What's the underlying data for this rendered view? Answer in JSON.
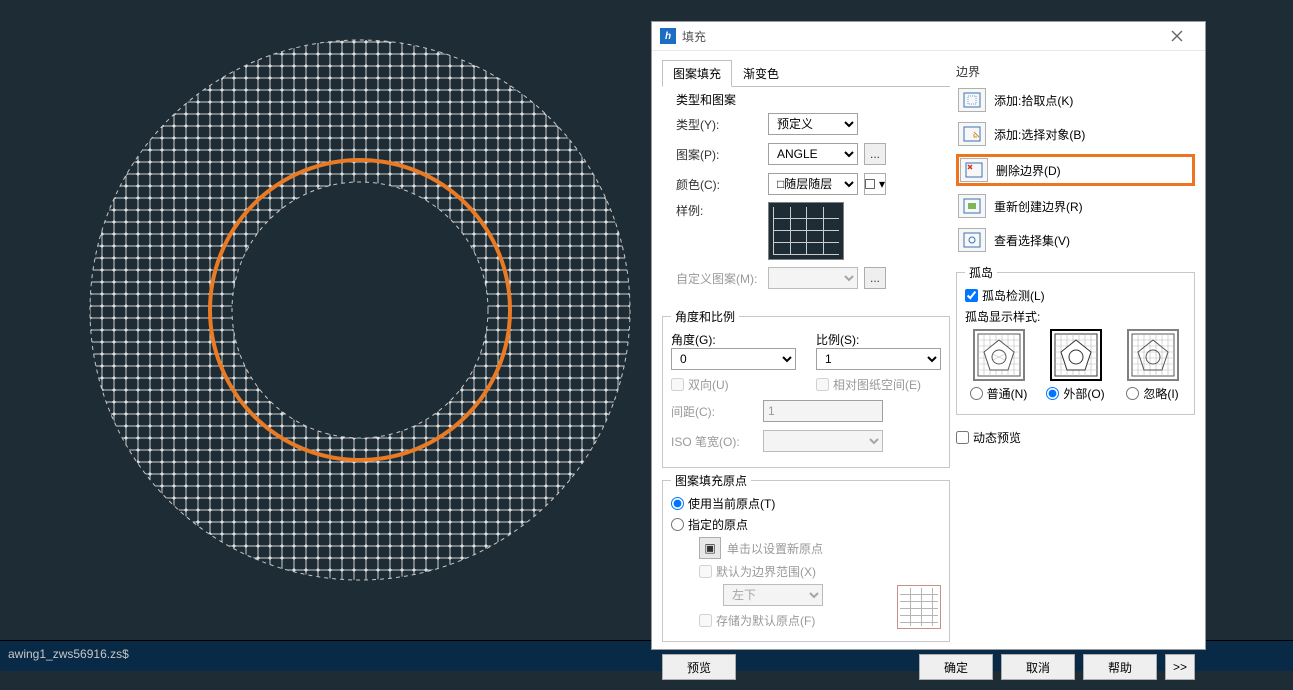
{
  "status_line": "awing1_zws56916.zs$",
  "dialog": {
    "title": "填充",
    "tabs": {
      "pattern": "图案填充",
      "gradient": "渐变色"
    },
    "type_group_title": "类型和图案",
    "type_label": "类型(Y):",
    "type_value": "预定义",
    "pattern_label": "图案(P):",
    "pattern_value": "ANGLE",
    "color_label": "颜色(C):",
    "color_value": "随层",
    "sample_label": "样例:",
    "custom_label": "自定义图案(M):",
    "ellipsis": "...",
    "angle_scale_title": "角度和比例",
    "angle_label": "角度(G):",
    "angle_value": "0",
    "scale_label": "比例(S):",
    "scale_value": "1",
    "double_dir": "双向(U)",
    "rel_paper": "相对图纸空间(E)",
    "spacing_label": "间距(C):",
    "spacing_value": "1",
    "iso_pen_label": "ISO 笔宽(O):",
    "origin_title": "图案填充原点",
    "use_current": "使用当前原点(T)",
    "specified": "指定的原点",
    "click_new": "单击以设置新原点",
    "default_range": "默认为边界范围(X)",
    "left_bottom": "左下",
    "store_default": "存储为默认原点(F)",
    "boundary_title": "边界",
    "add_pick": "添加:拾取点(K)",
    "add_select": "添加:选择对象(B)",
    "delete_boundary": "删除边界(D)",
    "recreate_boundary": "重新创建边界(R)",
    "view_selection": "查看选择集(V)",
    "island_title": "孤岛",
    "island_detect": "孤岛检测(L)",
    "island_display": "孤岛显示样式:",
    "normal": "普通(N)",
    "outer": "外部(O)",
    "ignore": "忽略(I)",
    "dynamic_preview": "动态预览",
    "preview_btn": "预览",
    "ok": "确定",
    "cancel": "取消",
    "help": "帮助",
    "expand": ">>"
  }
}
